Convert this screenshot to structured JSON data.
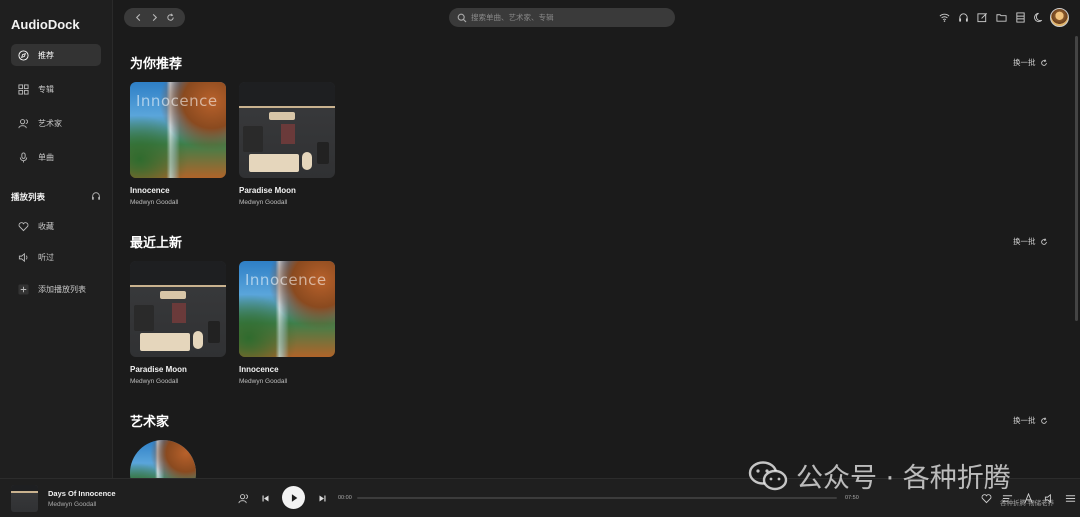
{
  "app": {
    "name": "AudioDock"
  },
  "sidebar": {
    "items": [
      {
        "label": "推荐",
        "icon": "compass-icon",
        "active": true
      },
      {
        "label": "专辑",
        "icon": "grid-icon",
        "active": false
      },
      {
        "label": "艺术家",
        "icon": "users-icon",
        "active": false
      },
      {
        "label": "单曲",
        "icon": "microphone-icon",
        "active": false
      }
    ],
    "playlist_section": {
      "title": "播放列表",
      "icon": "headphones-icon"
    },
    "playlist_items": [
      {
        "label": "收藏",
        "icon": "heart-icon"
      },
      {
        "label": "听过",
        "icon": "speaker-icon"
      },
      {
        "label": "添加播放列表",
        "icon": "plus-icon"
      }
    ]
  },
  "topbar": {
    "search_placeholder": "搜索单曲、艺术家、专辑",
    "icons": [
      "wifi-icon",
      "headphones-icon",
      "edit-icon",
      "folder-icon",
      "list-icon",
      "moon-icon"
    ]
  },
  "sections": [
    {
      "title": "为你推荐",
      "refresh_label": "换一批",
      "cards": [
        {
          "name": "Innocence",
          "artist": "Medwyn Goodall",
          "cover": "waterfall"
        },
        {
          "name": "Paradise Moon",
          "artist": "Medwyn Goodall",
          "cover": "desk"
        }
      ]
    },
    {
      "title": "最近上新",
      "refresh_label": "换一批",
      "cards": [
        {
          "name": "Paradise Moon",
          "artist": "Medwyn Goodall",
          "cover": "desk"
        },
        {
          "name": "Innocence",
          "artist": "Medwyn Goodall",
          "cover": "waterfall"
        }
      ]
    },
    {
      "title": "艺术家",
      "refresh_label": "换一批"
    }
  ],
  "cover_text": {
    "innocence_title": "Innocence"
  },
  "player": {
    "title": "Days Of Innocence",
    "artist": "Medwyn Goodall",
    "time_current": "00:00",
    "time_total": "07:50",
    "progress": 0
  },
  "watermark": {
    "text": "公众号 · 各种折腾",
    "small": "各种折腾·物储老养"
  },
  "colors": {
    "background": "#1b1b1b",
    "sidebar": "#1f1f1f",
    "accent": "#f2f2f2"
  }
}
